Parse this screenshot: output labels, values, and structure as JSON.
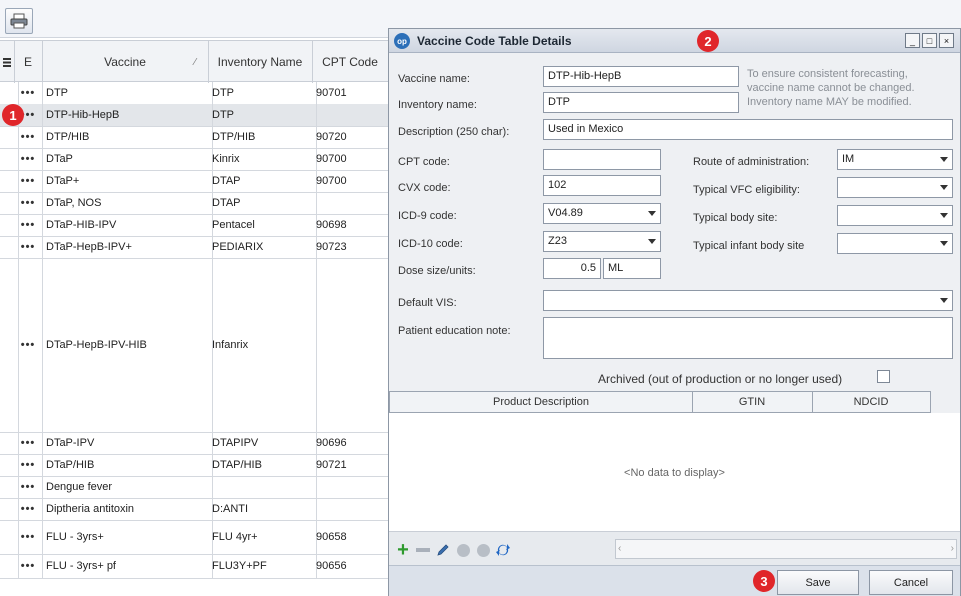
{
  "grid": {
    "headers": {
      "e": "E",
      "vaccine": "Vaccine",
      "inventory": "Inventory Name",
      "cpt": "CPT Code",
      "sort_glyph": "⁄"
    },
    "rows": [
      {
        "dots": "•••",
        "vaccine": "DTP",
        "inventory": "DTP",
        "cpt": "90701"
      },
      {
        "dots": "•••",
        "vaccine": "DTP-Hib-HepB",
        "inventory": "DTP",
        "cpt": ""
      },
      {
        "dots": "•••",
        "vaccine": "DTP/HIB",
        "inventory": "DTP/HIB",
        "cpt": "90720"
      },
      {
        "dots": "•••",
        "vaccine": "DTaP",
        "inventory": "Kinrix",
        "cpt": "90700"
      },
      {
        "dots": "•••",
        "vaccine": "DTaP+",
        "inventory": "DTAP",
        "cpt": "90700"
      },
      {
        "dots": "•••",
        "vaccine": "DTaP, NOS",
        "inventory": "DTAP",
        "cpt": ""
      },
      {
        "dots": "•••",
        "vaccine": "DTaP-HIB-IPV",
        "inventory": "Pentacel",
        "cpt": "90698"
      },
      {
        "dots": "•••",
        "vaccine": "DTaP-HepB-IPV+",
        "inventory": "PEDIARIX",
        "cpt": "90723"
      },
      {
        "dots": "•••",
        "vaccine": "DTaP-HepB-IPV-HIB",
        "inventory": "Infanrix",
        "cpt": ""
      },
      {
        "dots": "•••",
        "vaccine": "DTaP-IPV",
        "inventory": "DTAPIPV",
        "cpt": "90696"
      },
      {
        "dots": "•••",
        "vaccine": "DTaP/HIB",
        "inventory": "DTAP/HIB",
        "cpt": "90721"
      },
      {
        "dots": "•••",
        "vaccine": "Dengue fever",
        "inventory": "",
        "cpt": ""
      },
      {
        "dots": "•••",
        "vaccine": "Diptheria antitoxin",
        "inventory": "D:ANTI",
        "cpt": ""
      },
      {
        "dots": "•••",
        "vaccine": "FLU - 3yrs+",
        "inventory": "FLU 4yr+",
        "cpt": "90658"
      },
      {
        "dots": "•••",
        "vaccine": "FLU - 3yrs+ pf",
        "inventory": "FLU3Y+PF",
        "cpt": "90656"
      }
    ]
  },
  "badges": {
    "one": "1",
    "two": "2",
    "three": "3"
  },
  "dialog": {
    "title": "Vaccine Code Table Details",
    "logo": "op",
    "win_buttons": {
      "minimize": "_",
      "maximize": "□",
      "close": "×"
    },
    "fields": {
      "vaccine_name": {
        "label": "Vaccine name:",
        "value": "DTP-Hib-HepB"
      },
      "inventory_name": {
        "label": "Inventory name:",
        "value": "DTP"
      },
      "description": {
        "label": "Description (250 char):",
        "value": "Used in Mexico"
      },
      "cpt_code": {
        "label": "CPT code:",
        "value": ""
      },
      "cvx_code": {
        "label": "CVX code:",
        "value": "102"
      },
      "icd9_code": {
        "label": "ICD-9 code:",
        "value": "V04.89"
      },
      "icd10_code": {
        "label": "ICD-10 code:",
        "value": "Z23"
      },
      "dose": {
        "label": "Dose size/units:",
        "value": "0.5",
        "units": "ML"
      },
      "default_vis": {
        "label": "Default VIS:",
        "value": ""
      },
      "education_note": {
        "label": "Patient education note:",
        "value": ""
      },
      "route": {
        "label": "Route of administration:",
        "value": "IM"
      },
      "vfc": {
        "label": "Typical VFC eligibility:",
        "value": ""
      },
      "body_site": {
        "label": "Typical body site:",
        "value": ""
      },
      "infant_body_site": {
        "label": "Typical infant body site",
        "value": ""
      }
    },
    "note_lines": [
      "To ensure consistent forecasting,",
      "vaccine name cannot be changed.",
      "Inventory name MAY be modified."
    ],
    "archived_label": "Archived (out of production or no longer used)",
    "archived_checked": false,
    "product_grid": {
      "columns": [
        "Product Description",
        "GTIN",
        "NDCID"
      ],
      "empty_text": "<No data to display>"
    },
    "toolbar_icons": [
      "add-icon",
      "remove-icon",
      "edit-icon",
      "confirm-icon",
      "cancel-icon",
      "refresh-icon"
    ],
    "buttons": {
      "save": "Save",
      "cancel": "Cancel"
    }
  },
  "colors": {
    "badge": "#e0262a",
    "add": "#2e9a2e",
    "refresh": "#1f66c4"
  }
}
